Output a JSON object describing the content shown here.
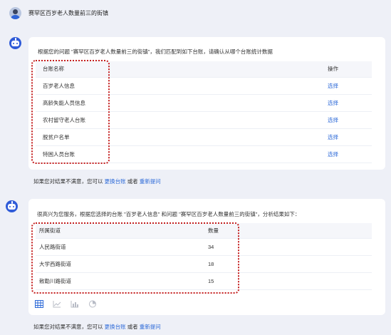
{
  "user": {
    "question": "赛罕区百岁老人数量前三的街镇"
  },
  "reply1": {
    "intro": "根据您的问题 \"赛罕区百岁老人数量前三的街镇\"，我们匹配到如下台账，请确认从哪个台账统计数据",
    "header": {
      "name": "台账名称",
      "action": "操作"
    },
    "rows": [
      {
        "name": "百岁老人信息",
        "action": "选择"
      },
      {
        "name": "高龄失能人员信息",
        "action": "选择"
      },
      {
        "name": "农村留守老人台账",
        "action": "选择"
      },
      {
        "name": "脱贫户名单",
        "action": "选择"
      },
      {
        "name": "特困人员台账",
        "action": "选择"
      }
    ]
  },
  "footer1": {
    "prefix": "如果您对结果不满意，您可以",
    "link1": "更换台账",
    "mid": "或者",
    "link2": "重新提问"
  },
  "reply2": {
    "intro": "很高兴为您服务，根据您选择的台账 \"百岁老人信息\" 和问题 \"赛罕区百岁老人数量前三的街镇\"，分析结果如下：",
    "header": {
      "street": "所属街道",
      "count": "数量"
    },
    "rows": [
      {
        "street": "人民路街道",
        "count": "34"
      },
      {
        "street": "大学西路街道",
        "count": "18"
      },
      {
        "street": "敕勒川路街道",
        "count": "15"
      }
    ]
  },
  "viewIcons": [
    "table-icon",
    "line-chart-icon",
    "bar-chart-icon",
    "pie-chart-icon"
  ],
  "footer2": {
    "prefix": "如果您对结果不满意，您可以",
    "link1": "更换台账",
    "mid": "或者",
    "link2": "重新提问"
  },
  "colors": {
    "accent": "#2f6bd8",
    "highlight": "#c41f1f",
    "background": "#eef0f7"
  }
}
